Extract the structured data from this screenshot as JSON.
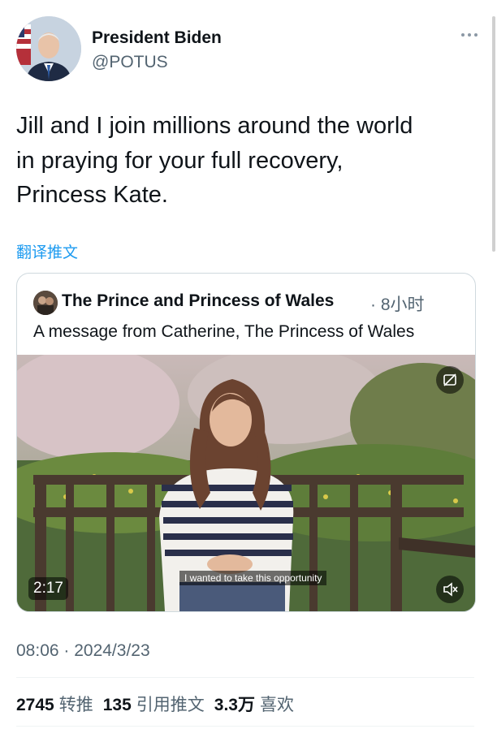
{
  "author": {
    "name": "President Biden",
    "handle": "@POTUS"
  },
  "tweet": {
    "text": "Jill and I join millions around the world\nin praying for your full recovery,\nPrincess Kate.",
    "translate_label": "翻译推文"
  },
  "quote": {
    "author_name": "The Prince and Princess of Wales",
    "time": "· 8小时",
    "text": "A message from Catherine, The Princess of Wales",
    "video": {
      "duration": "2:17",
      "caption": "I wanted to take this opportunity"
    }
  },
  "meta": {
    "timestamp": "08:06 · 2024/3/23"
  },
  "stats": {
    "retweets": "2745",
    "retweets_label": "转推",
    "quotes": "135",
    "quotes_label": "引用推文",
    "likes": "3.3万",
    "likes_label": "喜欢"
  },
  "colors": {
    "accent": "#1d9bf0",
    "secondary_text": "#536471",
    "border": "#cfd9de"
  },
  "icons": [
    "more-icon",
    "gif-icon",
    "mute-icon"
  ]
}
